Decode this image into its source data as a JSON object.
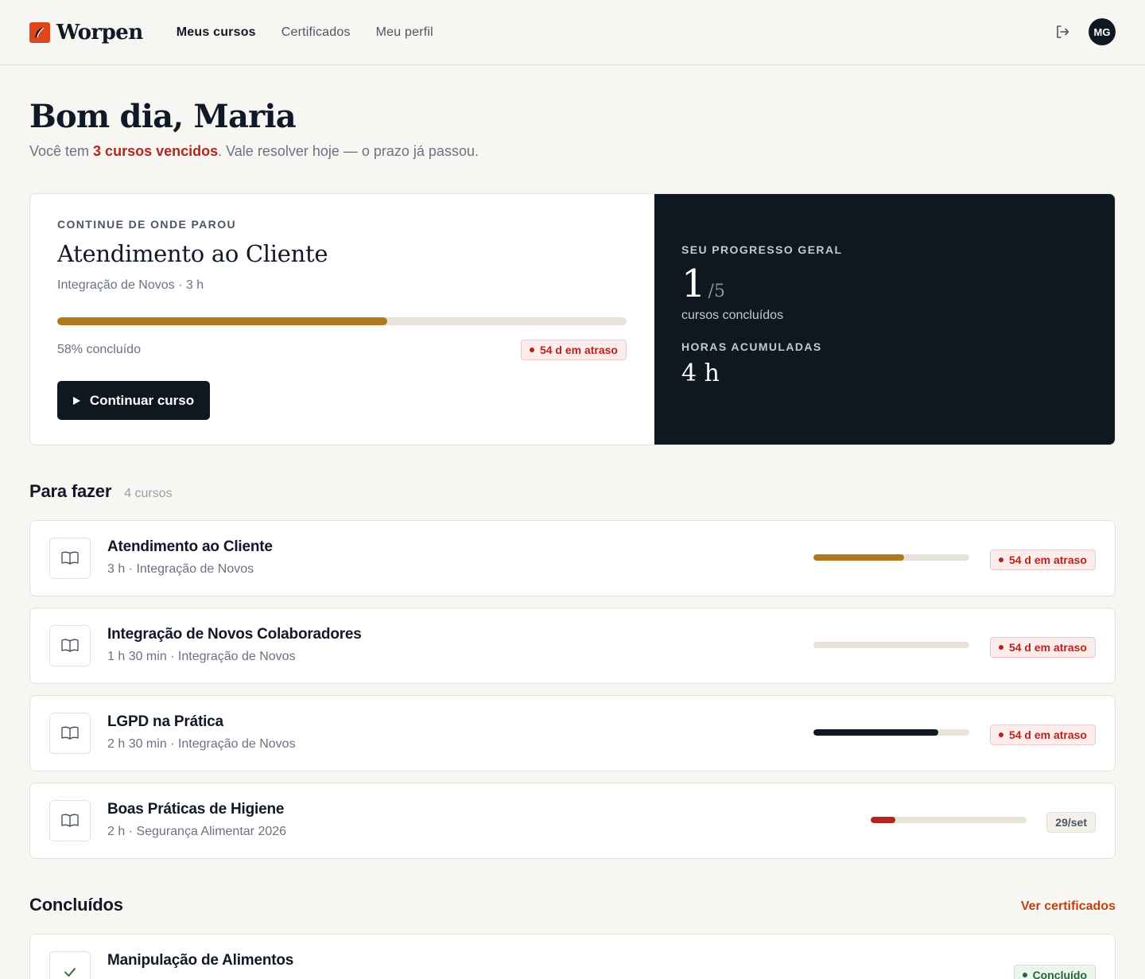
{
  "header": {
    "brand": "Worpen",
    "nav": [
      {
        "label": "Meus cursos",
        "active": true
      },
      {
        "label": "Certificados",
        "active": false
      },
      {
        "label": "Meu perfil",
        "active": false
      }
    ],
    "avatar_initials": "MG",
    "icons": [
      "brand-logo-icon",
      "logout-icon"
    ]
  },
  "greeting": {
    "title": "Bom dia, Maria",
    "pre": "Você tem ",
    "highlight": "3 cursos vencidos",
    "post": ". Vale resolver hoje — o prazo já passou."
  },
  "hero": {
    "eyebrow": "CONTINUE DE ONDE PAROU",
    "title": "Atendimento ao Cliente",
    "subtitle": "Integração de Novos · 3 h",
    "progress": 0.58,
    "progress_label": "58% concluído",
    "badge": "54 d em atraso",
    "button": "Continuar curso"
  },
  "overall": {
    "eyebrow": "SEU PROGRESSO GERAL",
    "completed": "1",
    "total": "/5",
    "completed_label": "cursos concluídos",
    "hours_eyebrow": "HORAS ACUMULADAS",
    "hours": "4 h"
  },
  "todo": {
    "title": "Para fazer",
    "count": "4 cursos",
    "items": [
      {
        "title": "Atendimento ao Cliente",
        "meta": "3 h · Integração de Novos",
        "progress": 0.58,
        "bar_color": "#b07a1c",
        "badge": "54 d em atraso",
        "badge_type": "late"
      },
      {
        "title": "Integração de Novos Colaboradores",
        "meta": "1 h 30 min · Integração de Novos",
        "progress": 0,
        "bar_color": "#b07a1c",
        "badge": "54 d em atraso",
        "badge_type": "late"
      },
      {
        "title": "LGPD na Prática",
        "meta": "2 h 30 min · Integração de Novos",
        "progress": 0.8,
        "bar_color": "#0f1720",
        "badge": "54 d em atraso",
        "badge_type": "late"
      },
      {
        "title": "Boas Práticas de Higiene",
        "meta": "2 h · Segurança Alimentar 2026",
        "progress": 0.16,
        "bar_color": "#b3261e",
        "badge": "29/set",
        "badge_type": "date"
      }
    ]
  },
  "done": {
    "title": "Concluídos",
    "link": "Ver certificados",
    "items": [
      {
        "title": "Manipulação de Alimentos",
        "badge": "Concluído"
      }
    ]
  }
}
